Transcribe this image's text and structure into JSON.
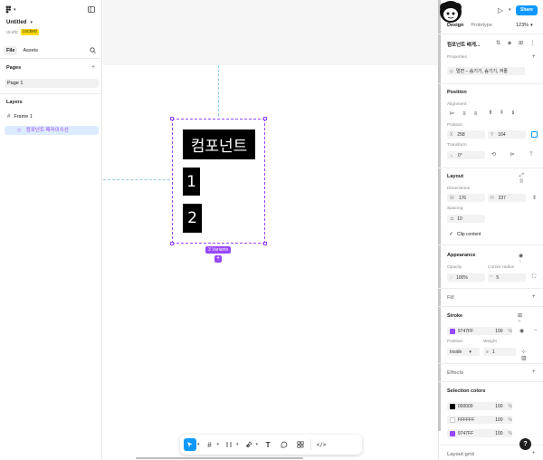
{
  "file": {
    "title": "Untitled",
    "owner": "ui-ufo",
    "status": "Locked",
    "tabs": [
      "File",
      "Assets"
    ],
    "pages_label": "Pages",
    "page_name": "Page 1",
    "layers_label": "Layers",
    "layer_frame": "Frame 1",
    "layer_component": "컴포넌트 패러이수선"
  },
  "canvas": {
    "block_text": "컴포넌트",
    "block_1": "1",
    "block_2": "2",
    "variant_pill": "3 Variants",
    "add_variant": "+",
    "frame_color": "#9747ff"
  },
  "header": {
    "tab_design": "Design",
    "tab_prototype": "Prototype",
    "zoom": "123%",
    "share": "Share"
  },
  "props": {
    "component_name": "컴포넌트 배게...",
    "properties_label": "Properties",
    "property_value": "멀면 – 숨기기, 숨기기, 켜줄"
  },
  "position": {
    "label": "Position",
    "alignment_label": "Alignment",
    "position_label": "Position",
    "x_label": "X",
    "x": "258",
    "y_label": "Y",
    "y": "164",
    "transform_label": "Transform",
    "rotation": "0°"
  },
  "layout": {
    "label": "Layout",
    "dimensions_label": "Dimensions",
    "w_label": "W",
    "w": "176",
    "h_label": "H",
    "h": "237",
    "spacing_label": "Spacing",
    "spacing": "10",
    "clip_content": "Clip content"
  },
  "appearance": {
    "label": "Appearance",
    "opacity_label": "Opacity",
    "opacity": "100%",
    "radius_label": "Corner radius",
    "radius": "5"
  },
  "fill": {
    "label": "Fill"
  },
  "stroke": {
    "label": "Stroke",
    "color_hex": "9747FF",
    "color": "#9747ff",
    "opacity": "100",
    "percent": "%",
    "position_label": "Position",
    "position": "Inside",
    "weight_label": "Weight",
    "weight": "1"
  },
  "effects": {
    "label": "Effects"
  },
  "selection_colors": {
    "label": "Selection colors",
    "items": [
      {
        "hex": "000000",
        "color": "#000000",
        "opacity": "100",
        "percent": "%"
      },
      {
        "hex": "FFFFFF",
        "color": "#ffffff",
        "opacity": "100",
        "percent": "%"
      },
      {
        "hex": "9747FF",
        "color": "#9747ff",
        "opacity": "100",
        "percent": "%"
      }
    ]
  },
  "layout_grid": {
    "label": "Layout grid"
  },
  "help": "?"
}
